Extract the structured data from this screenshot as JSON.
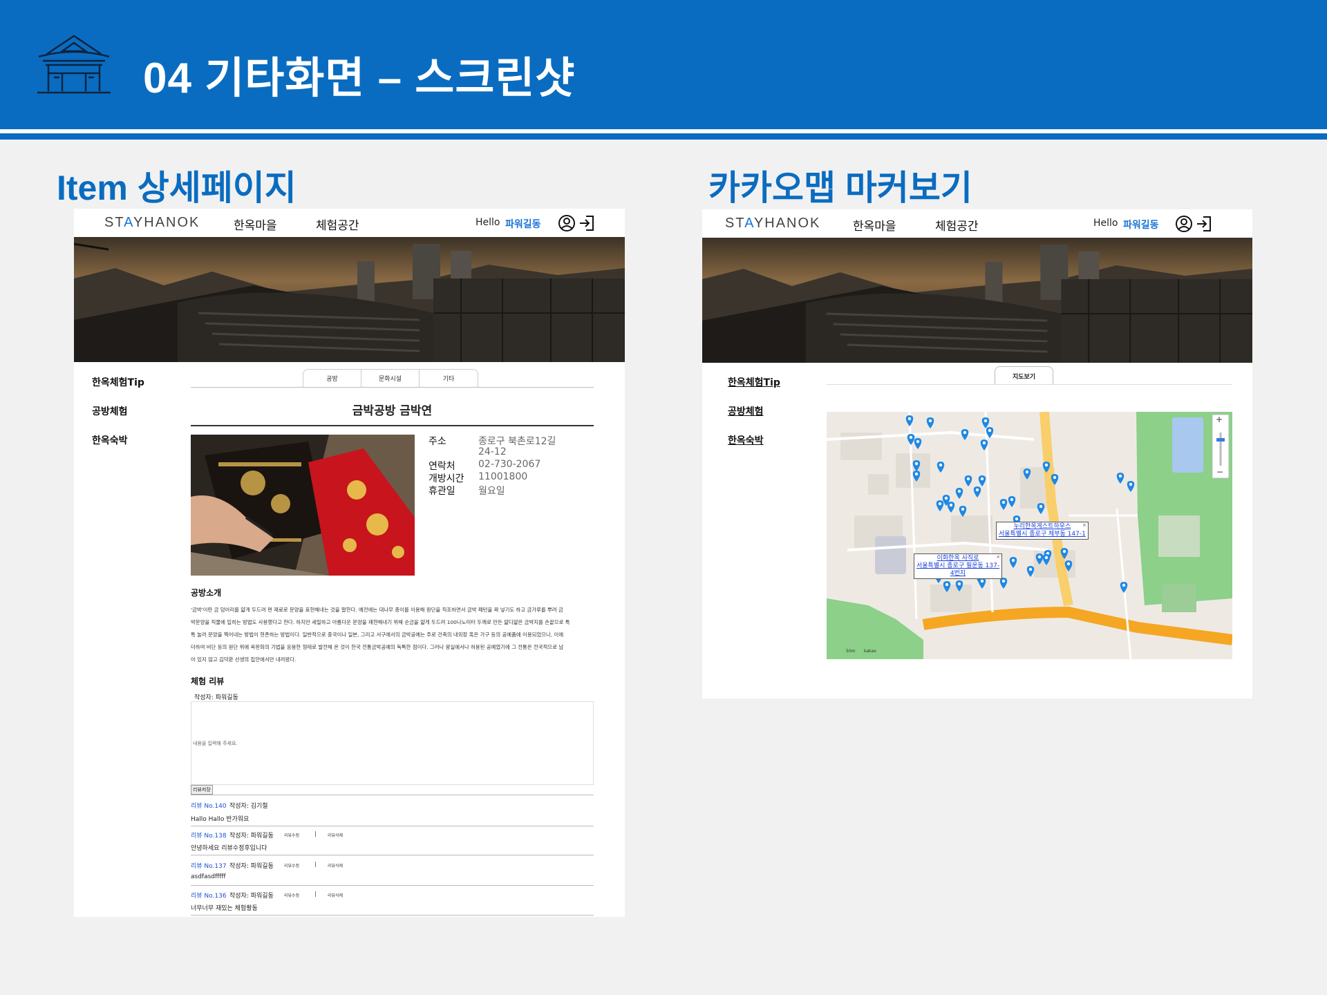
{
  "slide": {
    "title": "04 기타화면 – 스크린샷",
    "left_section": "Item 상세페이지",
    "right_section": "카카오맵 마커보기"
  },
  "nav": {
    "brand_prefix": "ST",
    "brand_accent": "A",
    "brand_suffix": "YHANOK",
    "links": [
      "한옥마을",
      "체험공간"
    ],
    "hello": "Hello",
    "user": "파워길동"
  },
  "sidebar": {
    "items": [
      "한옥체험Tip",
      "공방체험",
      "한옥숙박"
    ]
  },
  "detail": {
    "tabs": [
      "공방",
      "문화시설",
      "기타"
    ],
    "title": "금박공방 금박연",
    "info": [
      {
        "label": "주소",
        "value": "종로구 북촌로12길"
      },
      {
        "label": "",
        "value": "24-12"
      },
      {
        "label": "연락처",
        "value": "02-730-2067"
      },
      {
        "label": "개방시간",
        "value": "11001800"
      },
      {
        "label": "휴관일",
        "value": "월요일"
      }
    ],
    "intro_heading": "공방소개",
    "intro_lines": [
      "'금박'이란 금 덩어리를 얇게 두드려 편 재료로 문양을 표현해내는 것을 말한다. 예전에는 대나무 종이를 이용해 원단을 직조하면서 금박 패턴을 짜 넣기도 하고 금가루를 뿌려 금",
      "박문양을 직물에 입히는 방법도 사용했다고 한다. 하지만 세밀하고 아름다운 문양을 재현해내기 위해 순금을 얇게 두드려 100나노미터 두께로 만든 얇디얇은 금박지를 손끝으로 톡",
      "톡 눌러 문양을 찍어내는 방법이 현존하는 방법이다. 일반적으로 중국이나 일본, 그리고 서구에서의 금박공예는 주로 건축의 내외장 혹은 가구 등의 공예품에 이용되었으나, 이에",
      "더하여 비단 등의 원단 위에 옥판화의 기법을 응용한 형태로 발전해 온 것이 한국 전통금박공예의 독특한 점이다. 그러나 왕실에서나 허용된 공예였기에 그 전통은 전국적으로 남",
      "아 있지 않고 김덕환 선생의 집안에서만 내려왔다."
    ],
    "review_heading": "체험 리뷰",
    "review_author_prompt": "작성자: 파워길동",
    "review_placeholder": "내용을 입력해 주세요.",
    "save_label": "리뷰저장",
    "edit_label": "리뷰수정",
    "delete_label": "리뷰삭제",
    "separator": "|",
    "reviews": [
      {
        "no": "리뷰 No.140",
        "author": "작성자: 김기철",
        "text": "Hallo Hallo 반가워요",
        "own": false
      },
      {
        "no": "리뷰 No.138",
        "author": "작성자: 파워길동",
        "text": "안녕하세요 리뷰수정후입니다",
        "own": true
      },
      {
        "no": "리뷰 No.137",
        "author": "작성자: 파워길동",
        "text": "asdfasdfffff",
        "own": true
      },
      {
        "no": "리뷰 No.136",
        "author": "작성자: 파워길동",
        "text": "너무너무 재밌는 체험활동",
        "own": true
      }
    ]
  },
  "map": {
    "tab": "지도보기",
    "popups": [
      {
        "line1": "누리한옥게스트하우스",
        "line2": "서울특별시 종로구 체부동 147-1"
      },
      {
        "line1": "이화한옥 사직로",
        "line2": "서울특별시 종로구 필운동 137-",
        "line3": "4번지"
      }
    ],
    "zoom_in": "+",
    "zoom_out": "−",
    "scale_label": "50m",
    "provider": "kakao",
    "colors": {
      "marker": "#1e88e5",
      "road": "#f5a623",
      "park": "#7cc576",
      "water": "#aac8f0"
    }
  },
  "theme": {
    "accent": "#0a6cc0",
    "link": "#1a73d9"
  }
}
